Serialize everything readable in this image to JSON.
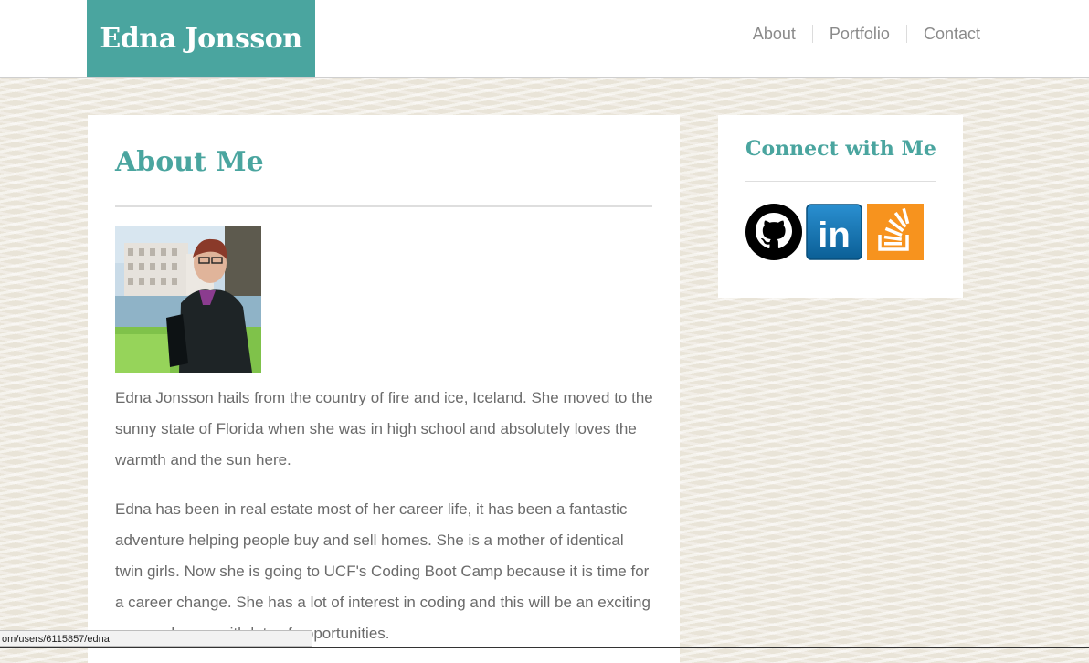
{
  "header": {
    "brand": "Edna Jonsson",
    "nav": [
      "About",
      "Portfolio",
      "Contact"
    ]
  },
  "main": {
    "title": "About Me",
    "paragraphs": [
      "Edna Jonsson hails from the country of fire and ice, Iceland. She moved to the sunny state of Florida when she was in high school and absolutely loves the warmth and the sun here.",
      "Edna has been in real estate most of her career life, it has been a fantastic adventure helping people buy and sell homes. She is a mother of identical twin girls. Now she is going to UCF's Coding Boot Camp because it is time for a career change. She has a lot of interest in coding and this will be an exciting career change with lots of opportunities."
    ]
  },
  "sidebar": {
    "title": "Connect with Me",
    "social": [
      "github-icon",
      "linkedin-icon",
      "stackoverflow-icon"
    ],
    "linkedin_text": "in"
  },
  "status_bar": {
    "url": "om/users/6115857/edna"
  },
  "colors": {
    "accent": "#4aa59f",
    "linkedin": "#0e76a8",
    "stackoverflow": "#f48024",
    "body_text": "#6b6b6b"
  }
}
